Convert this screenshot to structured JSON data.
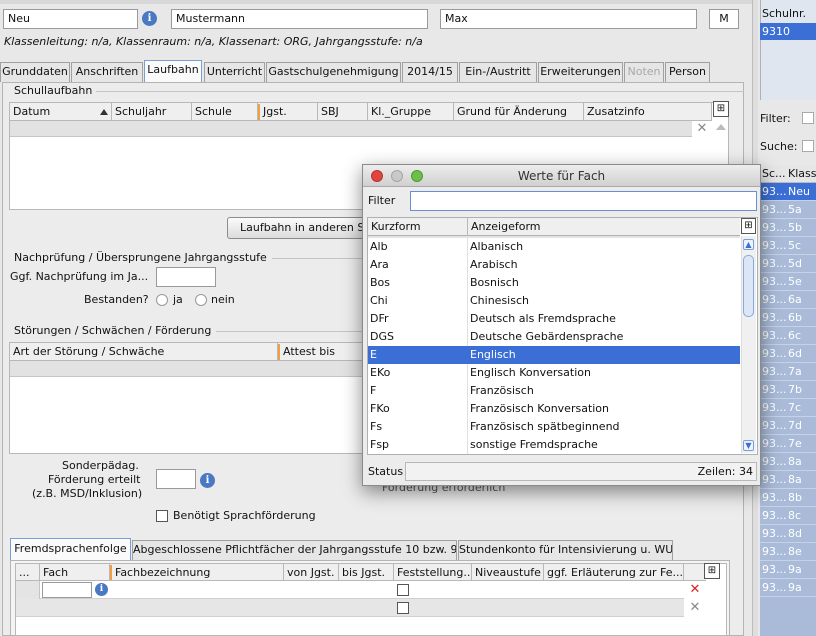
{
  "header": {
    "status_field": "Neu",
    "lastname": "Mustermann",
    "firstname": "Max",
    "gender": "M",
    "info_line": "Klassenleitung: n/a, Klassenraum: n/a, Klassenart: ORG, Jahrgangsstufe: n/a"
  },
  "tabs": [
    {
      "label": "Grunddaten"
    },
    {
      "label": "Anschriften"
    },
    {
      "label": "Laufbahn"
    },
    {
      "label": "Unterricht"
    },
    {
      "label": "Gastschulgenehmigung"
    },
    {
      "label": "2014/15"
    },
    {
      "label": "Ein-/Austritt"
    },
    {
      "label": "Erweiterungen"
    },
    {
      "label": "Noten"
    },
    {
      "label": "Person"
    }
  ],
  "schullaufbahn": {
    "title": "Schullaufbahn",
    "columns": [
      "Datum",
      "Schuljahr",
      "Schule",
      "Jgst.",
      "SBJ",
      "Kl._Gruppe",
      "Grund für Änderung",
      "Zusatzinfo"
    ],
    "button": "Laufbahn in anderen Sc"
  },
  "nachpruefung": {
    "title": "Nachprüfung / Übersprungene Jahrgangsstufe",
    "label": "Ggf. Nachprüfung im Ja...",
    "bestanden_label": "Bestanden?",
    "opt_ja": "ja",
    "opt_nein": "nein"
  },
  "stoerungen": {
    "title": "Störungen / Schwächen / Förderung",
    "col1": "Art der Störung / Schwäche",
    "col2": "Attest bis"
  },
  "foerderung": {
    "line1": "Sonderpädag.",
    "line2": "Förderung erteilt",
    "line3": "(z.B. MSD/Inklusion)",
    "sprachfoerderung": "Benötigt Sprachförderung",
    "behind_dialog": "Förderung erforderlich"
  },
  "bottom_tabs": [
    {
      "label": "Fremdsprachenfolge"
    },
    {
      "label": "Abgeschlossene Pflichtfächer der Jahrgangsstufe 10 bzw. 9"
    },
    {
      "label": "Stundenkonto für Intensivierung u. WU"
    }
  ],
  "fremdsprachen": {
    "columns": [
      "...",
      "Fach",
      "Fachbezeichnung",
      "von Jgst.",
      "bis Jgst.",
      "Feststellung...",
      "Niveaustufe",
      "ggf. Erläuterung zur Fe..."
    ]
  },
  "right_panel": {
    "schulnr_label": "Schulnr.",
    "schulnr_value": "9310",
    "filter_label": "Filter:",
    "suche_label": "Suche:",
    "col1": "Sc...",
    "col2": "Klasse",
    "rows": [
      {
        "sc": "93...",
        "kl": "Neu"
      },
      {
        "sc": "93...",
        "kl": "5a"
      },
      {
        "sc": "93...",
        "kl": "5b"
      },
      {
        "sc": "93...",
        "kl": "5c"
      },
      {
        "sc": "93...",
        "kl": "5d"
      },
      {
        "sc": "93...",
        "kl": "5e"
      },
      {
        "sc": "93...",
        "kl": "6a"
      },
      {
        "sc": "93...",
        "kl": "6b"
      },
      {
        "sc": "93...",
        "kl": "6c"
      },
      {
        "sc": "93...",
        "kl": "6d"
      },
      {
        "sc": "93...",
        "kl": "7a"
      },
      {
        "sc": "93...",
        "kl": "7b"
      },
      {
        "sc": "93...",
        "kl": "7c"
      },
      {
        "sc": "93...",
        "kl": "7d"
      },
      {
        "sc": "93...",
        "kl": "7e"
      },
      {
        "sc": "93...",
        "kl": "8a"
      },
      {
        "sc": "93...",
        "kl": "8a"
      },
      {
        "sc": "93...",
        "kl": "8b"
      },
      {
        "sc": "93...",
        "kl": "8c"
      },
      {
        "sc": "93...",
        "kl": "8d"
      },
      {
        "sc": "93...",
        "kl": "8e"
      },
      {
        "sc": "93...",
        "kl": "9a"
      },
      {
        "sc": "93...",
        "kl": "9a"
      }
    ]
  },
  "dialog": {
    "title": "Werte für Fach",
    "filter_label": "Filter",
    "filter_value": "",
    "col_kurz": "Kurzform",
    "col_anzeige": "Anzeigeform",
    "rows": [
      {
        "k": "Alb",
        "v": "Albanisch"
      },
      {
        "k": "Ara",
        "v": "Arabisch"
      },
      {
        "k": "Bos",
        "v": "Bosnisch"
      },
      {
        "k": "Chi",
        "v": "Chinesisch"
      },
      {
        "k": "DFr",
        "v": "Deutsch als Fremdsprache"
      },
      {
        "k": "DGS",
        "v": "Deutsche Gebärdensprache"
      },
      {
        "k": "E",
        "v": "Englisch"
      },
      {
        "k": "EKo",
        "v": "Englisch Konversation"
      },
      {
        "k": "F",
        "v": "Französisch"
      },
      {
        "k": "FKo",
        "v": "Französisch Konversation"
      },
      {
        "k": "Fs",
        "v": "Französisch spätbeginnend"
      },
      {
        "k": "Fsp",
        "v": "sonstige Fremdsprache"
      }
    ],
    "selected_index": 6,
    "status_label": "Status",
    "rows_count": "Zeilen: 34"
  },
  "colors": {
    "selection": "#3b6fd6",
    "right_panel": "#a9bbd8",
    "orange_sep": "#f0a040"
  },
  "icons": {
    "info": "i",
    "close_x": "✕",
    "column_chooser": "⊞"
  }
}
